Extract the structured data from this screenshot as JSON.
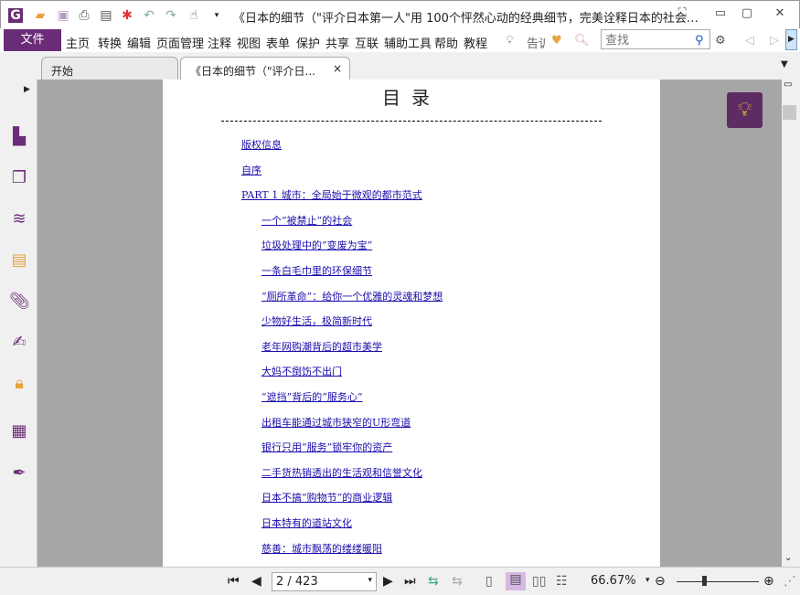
{
  "titlebar": {
    "app_icon": "foxit-logo-icon",
    "title": "《日本的细节（\"评介日本第一人\"用 100个怦然心动的经典细节，完美诠释日本的社会…",
    "quick_access": [
      "open-icon",
      "save-icon",
      "print-icon",
      "properties-icon",
      "new-icon",
      "undo-icon",
      "redo-icon",
      "hand-tool-icon"
    ]
  },
  "menubar": {
    "file": "文件",
    "items": [
      "主页",
      "转换",
      "编辑",
      "页面管理",
      "注释",
      "视图",
      "表单",
      "保护",
      "共享",
      "互联",
      "辅助工具",
      "帮助",
      "教程"
    ],
    "tell_me": "告诉",
    "search_placeholder": "查找"
  },
  "tabs": [
    {
      "label": "开始"
    },
    {
      "label": "《日本的细节（\"评介日...",
      "close": "×"
    }
  ],
  "document": {
    "toc_title": "目录",
    "entries": [
      {
        "text": "版权信息",
        "level": 1
      },
      {
        "text": "自序",
        "level": 1
      },
      {
        "text": "PART 1 城市：全局始于微观的都市范式",
        "level": 1
      },
      {
        "text": "一个“被禁止”的社会",
        "level": 2
      },
      {
        "text": "垃圾处理中的“变废为宝”",
        "level": 2
      },
      {
        "text": "一条白毛巾里的环保细节",
        "level": 2
      },
      {
        "text": "“厕所革命”：给你一个优雅的灵魂和梦想",
        "level": 2
      },
      {
        "text": "少物好生活，极简新时代",
        "level": 2
      },
      {
        "text": "老年网购潮背后的超市美学",
        "level": 2
      },
      {
        "text": "大妈不捯饬不出门",
        "level": 2
      },
      {
        "text": "“遮挡”背后的“服务心”",
        "level": 2
      },
      {
        "text": "出租车能通过城市狭窄的U形弯道",
        "level": 2
      },
      {
        "text": "银行只用“服务”锁牢你的资产",
        "level": 2
      },
      {
        "text": "二手货热销透出的生活观和信誉文化",
        "level": 2
      },
      {
        "text": "日本不搞“购物节”的商业逻辑",
        "level": 2
      },
      {
        "text": "日本特有的道站文化",
        "level": 2
      },
      {
        "text": "慈善：城市飘荡的缕缕暖阳",
        "level": 2
      }
    ]
  },
  "statusbar": {
    "page": "2 / 423",
    "zoom": "66.67%"
  },
  "colors": {
    "accent": "#6b2c77",
    "link": "#1a0dab",
    "viewer_bg": "#a6a6a6"
  }
}
